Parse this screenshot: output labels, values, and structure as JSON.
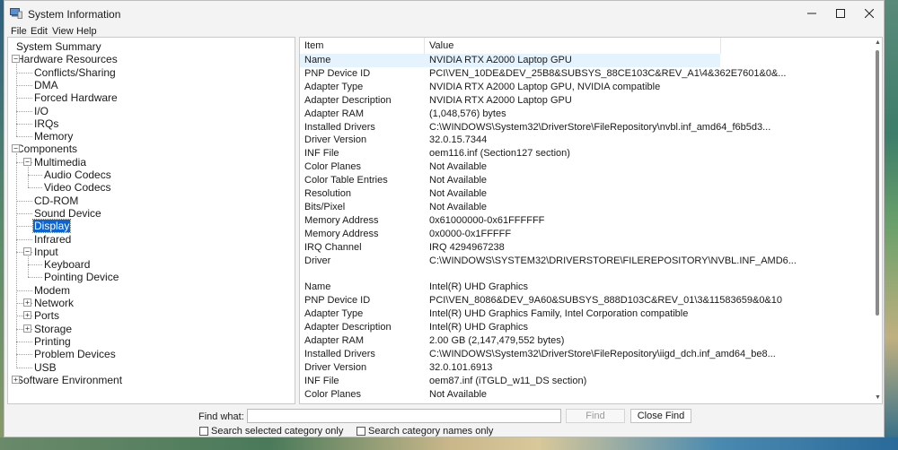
{
  "window": {
    "title": "System Information"
  },
  "menu": [
    "File",
    "Edit",
    "View",
    "Help"
  ],
  "tree": [
    {
      "label": "System Summary",
      "level": 0,
      "expander": ""
    },
    {
      "label": "Hardware Resources",
      "level": 0,
      "expander": "−"
    },
    {
      "label": "Conflicts/Sharing",
      "level": 1,
      "expander": ""
    },
    {
      "label": "DMA",
      "level": 1,
      "expander": ""
    },
    {
      "label": "Forced Hardware",
      "level": 1,
      "expander": ""
    },
    {
      "label": "I/O",
      "level": 1,
      "expander": ""
    },
    {
      "label": "IRQs",
      "level": 1,
      "expander": ""
    },
    {
      "label": "Memory",
      "level": 1,
      "expander": ""
    },
    {
      "label": "Components",
      "level": 0,
      "expander": "−"
    },
    {
      "label": "Multimedia",
      "level": 1,
      "expander": "−"
    },
    {
      "label": "Audio Codecs",
      "level": 2,
      "expander": ""
    },
    {
      "label": "Video Codecs",
      "level": 2,
      "expander": ""
    },
    {
      "label": "CD-ROM",
      "level": 1,
      "expander": ""
    },
    {
      "label": "Sound Device",
      "level": 1,
      "expander": ""
    },
    {
      "label": "Display",
      "level": 1,
      "expander": "",
      "selected": true
    },
    {
      "label": "Infrared",
      "level": 1,
      "expander": ""
    },
    {
      "label": "Input",
      "level": 1,
      "expander": "−"
    },
    {
      "label": "Keyboard",
      "level": 2,
      "expander": ""
    },
    {
      "label": "Pointing Device",
      "level": 2,
      "expander": ""
    },
    {
      "label": "Modem",
      "level": 1,
      "expander": ""
    },
    {
      "label": "Network",
      "level": 1,
      "expander": "+"
    },
    {
      "label": "Ports",
      "level": 1,
      "expander": "+"
    },
    {
      "label": "Storage",
      "level": 1,
      "expander": "+"
    },
    {
      "label": "Printing",
      "level": 1,
      "expander": ""
    },
    {
      "label": "Problem Devices",
      "level": 1,
      "expander": ""
    },
    {
      "label": "USB",
      "level": 1,
      "expander": ""
    },
    {
      "label": "Software Environment",
      "level": 0,
      "expander": "+"
    }
  ],
  "columns": {
    "item": "Item",
    "value": "Value"
  },
  "rows": [
    {
      "item": "Name",
      "value": "NVIDIA RTX A2000 Laptop GPU",
      "highlight": true
    },
    {
      "item": "PNP Device ID",
      "value": "PCI\\VEN_10DE&DEV_25B8&SUBSYS_88CE103C&REV_A1\\4&362E7601&0&..."
    },
    {
      "item": "Adapter Type",
      "value": "NVIDIA RTX A2000 Laptop GPU, NVIDIA compatible"
    },
    {
      "item": "Adapter Description",
      "value": "NVIDIA RTX A2000 Laptop GPU"
    },
    {
      "item": "Adapter RAM",
      "value": "(1,048,576) bytes"
    },
    {
      "item": "Installed Drivers",
      "value": "C:\\WINDOWS\\System32\\DriverStore\\FileRepository\\nvbl.inf_amd64_f6b5d3..."
    },
    {
      "item": "Driver Version",
      "value": "32.0.15.7344"
    },
    {
      "item": "INF File",
      "value": "oem116.inf (Section127 section)"
    },
    {
      "item": "Color Planes",
      "value": "Not Available"
    },
    {
      "item": "Color Table Entries",
      "value": "Not Available"
    },
    {
      "item": "Resolution",
      "value": "Not Available"
    },
    {
      "item": "Bits/Pixel",
      "value": "Not Available"
    },
    {
      "item": "Memory Address",
      "value": "0x61000000-0x61FFFFFF"
    },
    {
      "item": "Memory Address",
      "value": "0x0000-0x1FFFFF"
    },
    {
      "item": "IRQ Channel",
      "value": "IRQ 4294967238"
    },
    {
      "item": "Driver",
      "value": "C:\\WINDOWS\\SYSTEM32\\DRIVERSTORE\\FILEREPOSITORY\\NVBL.INF_AMD6..."
    },
    {
      "item": "",
      "value": ""
    },
    {
      "item": "Name",
      "value": "Intel(R) UHD Graphics"
    },
    {
      "item": "PNP Device ID",
      "value": "PCI\\VEN_8086&DEV_9A60&SUBSYS_888D103C&REV_01\\3&11583659&0&10"
    },
    {
      "item": "Adapter Type",
      "value": "Intel(R) UHD Graphics Family, Intel Corporation compatible"
    },
    {
      "item": "Adapter Description",
      "value": "Intel(R) UHD Graphics"
    },
    {
      "item": "Adapter RAM",
      "value": "2.00 GB (2,147,479,552 bytes)"
    },
    {
      "item": "Installed Drivers",
      "value": "C:\\WINDOWS\\System32\\DriverStore\\FileRepository\\iigd_dch.inf_amd64_be8..."
    },
    {
      "item": "Driver Version",
      "value": "32.0.101.6913"
    },
    {
      "item": "INF File",
      "value": "oem87.inf (iTGLD_w11_DS section)"
    },
    {
      "item": "Color Planes",
      "value": "Not Available"
    }
  ],
  "find": {
    "label": "Find what:",
    "value": "",
    "find_button": "Find",
    "close_button": "Close Find",
    "option1": "Search selected category only",
    "option2": "Search category names only"
  },
  "colors": {
    "selection": "#0a64d4",
    "row_highlight": "#e5f3ff"
  }
}
